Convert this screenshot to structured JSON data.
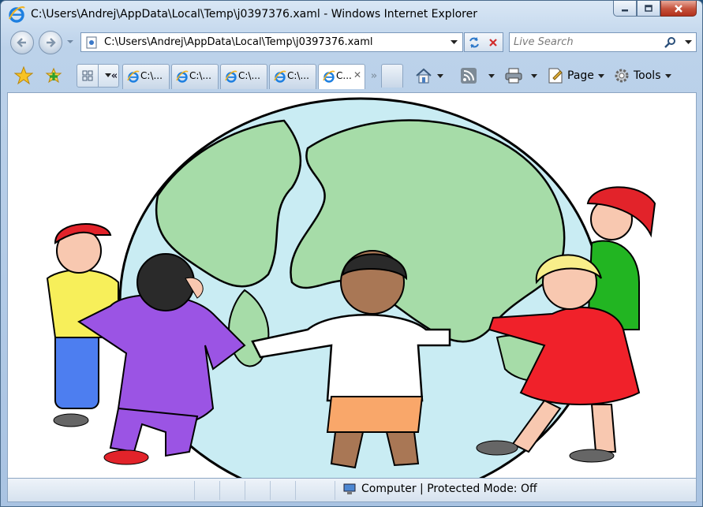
{
  "window": {
    "title": "C:\\Users\\Andrej\\AppData\\Local\\Temp\\j0397376.xaml - Windows Internet Explorer",
    "caption_buttons": [
      "minimize-icon",
      "maximize-icon",
      "close-icon"
    ]
  },
  "address_bar": {
    "url": "C:\\Users\\Andrej\\AppData\\Local\\Temp\\j0397376.xaml",
    "refresh_icon": "refresh-icon",
    "stop_icon": "stop-icon"
  },
  "search": {
    "placeholder": "Live Search"
  },
  "tabs": [
    {
      "label": "C:\\...",
      "active": false
    },
    {
      "label": "C:\\...",
      "active": false
    },
    {
      "label": "C:\\...",
      "active": false
    },
    {
      "label": "C:\\...",
      "active": false
    },
    {
      "label": "C...",
      "active": true
    }
  ],
  "tab_nav": {
    "left": "«",
    "right": "»"
  },
  "command_bar": {
    "page_label": "Page",
    "tools_label": "Tools"
  },
  "status_bar": {
    "zone_text": "Computer | Protected Mode: Off"
  },
  "colors": {
    "ocean": "#c9ecf3",
    "land": "#a6dca8",
    "shirt_yellow": "#f7ef5a",
    "pants_blue": "#4d7ef0",
    "purple": "#9b54e4",
    "green_shirt": "#22b522",
    "red_dress": "#f0212a",
    "cap_red": "#e2232a",
    "orange_shorts": "#f9a76a",
    "skin_light": "#f8c8b0",
    "skin_dark": "#a97755",
    "blonde": "#f8ee8a"
  }
}
